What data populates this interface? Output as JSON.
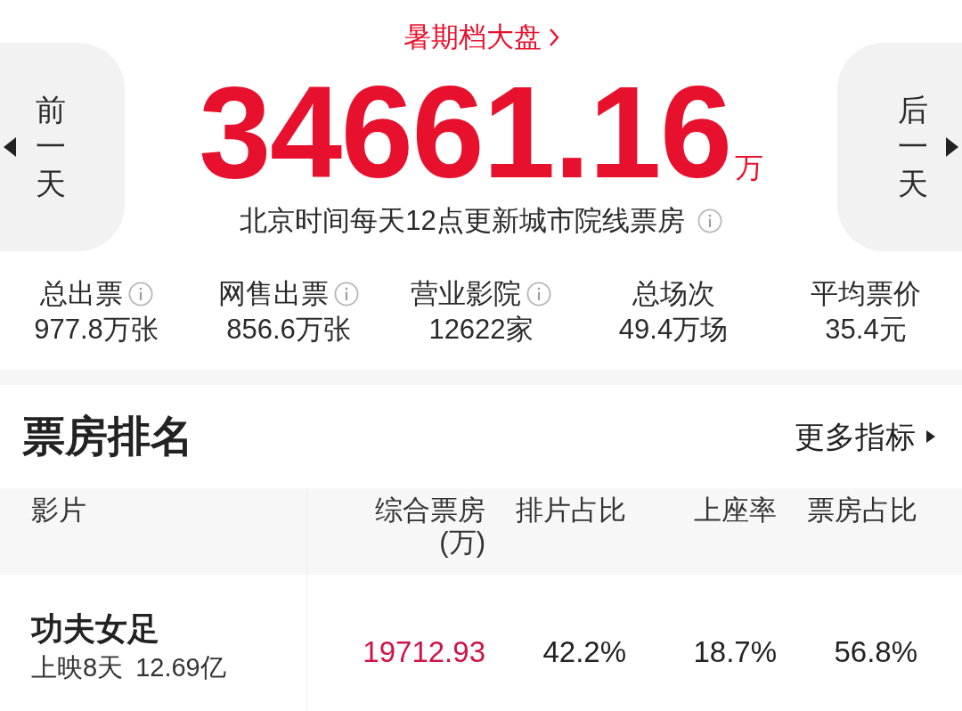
{
  "header": {
    "link": "暑期档大盘",
    "total": "34661.16",
    "unit": "万",
    "note": "北京时间每天12点更新城市院线票房",
    "note_info": true
  },
  "nav": [
    {
      "label": "前一天",
      "kind": "prev"
    },
    {
      "label": "后一天",
      "kind": "next"
    }
  ],
  "stats": [
    {
      "label": "总出票",
      "value": "977.8万张",
      "info": true
    },
    {
      "label": "网售出票",
      "value": "856.6万张",
      "info": true
    },
    {
      "label": "营业影院",
      "value": "12622家",
      "info": true
    },
    {
      "label": "总场次",
      "value": "49.4万场",
      "info": false
    },
    {
      "label": "平均票价",
      "value": "35.4元",
      "info": false
    }
  ],
  "ranking": {
    "title": "票房排名",
    "more": "更多指标",
    "columns": [
      {
        "label": "影片",
        "kind": "title"
      },
      {
        "label": "综合票房",
        "unit": "(万)",
        "kind": "number",
        "highlight": true
      },
      {
        "label": "排片占比",
        "kind": "number",
        "highlight": false
      },
      {
        "label": "上座率",
        "kind": "number",
        "highlight": false
      },
      {
        "label": "票房占比",
        "kind": "number",
        "highlight": false
      }
    ],
    "rows": [
      {
        "cells": [
          {
            "title": "功夫女足",
            "days": "上映8天",
            "cumulative": "12.69亿"
          },
          {
            "text": "19712.93"
          },
          {
            "text": "42.2%"
          },
          {
            "text": "18.7%"
          },
          {
            "text": "56.8%"
          }
        ]
      }
    ]
  }
}
